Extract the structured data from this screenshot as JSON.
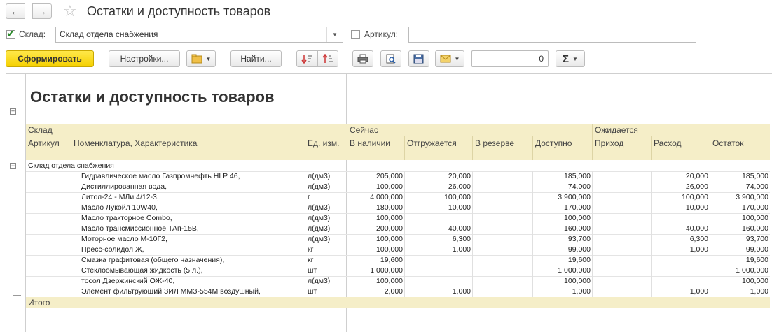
{
  "window": {
    "title": "Остатки и доступность товаров"
  },
  "filters": {
    "warehouse_label": "Склад:",
    "warehouse_value": "Склад отдела снабжения",
    "warehouse_checked": true,
    "article_label": "Артикул:",
    "article_value": "",
    "article_checked": false
  },
  "toolbar": {
    "generate_label": "Сформировать",
    "settings_label": "Настройки...",
    "find_label": "Найти...",
    "number_value": "0",
    "sigma_label": "Σ"
  },
  "report": {
    "title": "Остатки и доступность товаров",
    "headers": {
      "warehouse": "Склад",
      "article": "Артикул",
      "nomenclature": "Номенклатура, Характеристика",
      "unit": "Ед. изм.",
      "now": "Сейчас",
      "in_stock": "В наличии",
      "shipping": "Отгружается",
      "reserved": "В резерве",
      "available": "Доступно",
      "expected": "Ожидается",
      "income": "Приход",
      "expense": "Расход",
      "balance": "Остаток"
    },
    "group_name": "Склад отдела снабжения",
    "total_label": "Итого",
    "rows": [
      {
        "name": "Гидравлическое масло Газпромнефть HLP 46,",
        "unit": "л(дм3)",
        "in_stock": "205,000",
        "shipping": "20,000",
        "reserved": "",
        "available": "185,000",
        "income": "",
        "expense": "20,000",
        "balance": "185,000"
      },
      {
        "name": "Дистиллированная вода,",
        "unit": "л(дм3)",
        "in_stock": "100,000",
        "shipping": "26,000",
        "reserved": "",
        "available": "74,000",
        "income": "",
        "expense": "26,000",
        "balance": "74,000"
      },
      {
        "name": "Литол-24 - МЛи 4/12-3,",
        "unit": "г",
        "in_stock": "4 000,000",
        "shipping": "100,000",
        "reserved": "",
        "available": "3 900,000",
        "income": "",
        "expense": "100,000",
        "balance": "3 900,000"
      },
      {
        "name": "Масло Лукойл 10W40,",
        "unit": "л(дм3)",
        "in_stock": "180,000",
        "shipping": "10,000",
        "reserved": "",
        "available": "170,000",
        "income": "",
        "expense": "10,000",
        "balance": "170,000"
      },
      {
        "name": "Масло тракторное Combo,",
        "unit": "л(дм3)",
        "in_stock": "100,000",
        "shipping": "",
        "reserved": "",
        "available": "100,000",
        "income": "",
        "expense": "",
        "balance": "100,000"
      },
      {
        "name": "Масло трансмиссионное ТАп-15В,",
        "unit": "л(дм3)",
        "in_stock": "200,000",
        "shipping": "40,000",
        "reserved": "",
        "available": "160,000",
        "income": "",
        "expense": "40,000",
        "balance": "160,000"
      },
      {
        "name": "Моторное масло М-10Г2,",
        "unit": "л(дм3)",
        "in_stock": "100,000",
        "shipping": "6,300",
        "reserved": "",
        "available": "93,700",
        "income": "",
        "expense": "6,300",
        "balance": "93,700"
      },
      {
        "name": "Пресс-солидол Ж,",
        "unit": "кг",
        "in_stock": "100,000",
        "shipping": "1,000",
        "reserved": "",
        "available": "99,000",
        "income": "",
        "expense": "1,000",
        "balance": "99,000"
      },
      {
        "name": "Смазка графитовая (общего назначения),",
        "unit": "кг",
        "in_stock": "19,600",
        "shipping": "",
        "reserved": "",
        "available": "19,600",
        "income": "",
        "expense": "",
        "balance": "19,600"
      },
      {
        "name": "Стеклоомывающая жидкость (5 л.),",
        "unit": "шт",
        "in_stock": "1 000,000",
        "shipping": "",
        "reserved": "",
        "available": "1 000,000",
        "income": "",
        "expense": "",
        "balance": "1 000,000"
      },
      {
        "name": "тосол Дзержинский ОЖ-40,",
        "unit": "л(дм3)",
        "in_stock": "100,000",
        "shipping": "",
        "reserved": "",
        "available": "100,000",
        "income": "",
        "expense": "",
        "balance": "100,000"
      },
      {
        "name": "Элемент фильтрующий ЗИЛ ММЗ-554М воздушный,",
        "unit": "шт",
        "in_stock": "2,000",
        "shipping": "1,000",
        "reserved": "",
        "available": "1,000",
        "income": "",
        "expense": "1,000",
        "balance": "1,000"
      }
    ]
  }
}
